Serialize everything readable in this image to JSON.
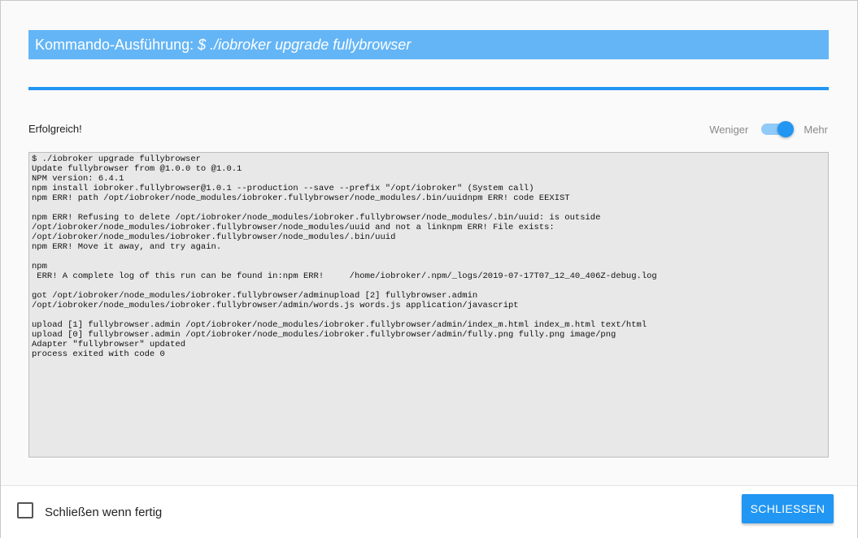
{
  "dialog": {
    "title_prefix": "Kommando-Ausführung: ",
    "title_command": "$ ./iobroker upgrade fullybrowser",
    "status": "Erfolgreich!",
    "progress": 1.0,
    "toggle": {
      "left_label": "Weniger",
      "right_label": "Mehr",
      "state": "Mehr",
      "accent": "#2196f3"
    },
    "log_lines": [
      "$ ./iobroker upgrade fullybrowser",
      "Update fullybrowser from @1.0.0 to @1.0.1",
      "NPM version: 6.4.1",
      "npm install iobroker.fullybrowser@1.0.1 --production --save --prefix \"/opt/iobroker\" (System call)",
      "npm ERR! path /opt/iobroker/node_modules/iobroker.fullybrowser/node_modules/.bin/uuidnpm ERR! code EEXIST",
      "",
      "npm ERR! Refusing to delete /opt/iobroker/node_modules/iobroker.fullybrowser/node_modules/.bin/uuid: is outside",
      "/opt/iobroker/node_modules/iobroker.fullybrowser/node_modules/uuid and not a linknpm ERR! File exists:",
      "/opt/iobroker/node_modules/iobroker.fullybrowser/node_modules/.bin/uuid",
      "npm ERR! Move it away, and try again.",
      "",
      "npm",
      " ERR! A complete log of this run can be found in:npm ERR!     /home/iobroker/.npm/_logs/2019-07-17T07_12_40_406Z-debug.log",
      "",
      "got /opt/iobroker/node_modules/iobroker.fullybrowser/adminupload [2] fullybrowser.admin",
      "/opt/iobroker/node_modules/iobroker.fullybrowser/admin/words.js words.js application/javascript",
      "",
      "upload [1] fullybrowser.admin /opt/iobroker/node_modules/iobroker.fullybrowser/admin/index_m.html index_m.html text/html",
      "upload [0] fullybrowser.admin /opt/iobroker/node_modules/iobroker.fullybrowser/admin/fully.png fully.png image/png",
      "Adapter \"fullybrowser\" updated",
      "process exited with code 0"
    ]
  },
  "footer": {
    "checkbox_label": "Schließen wenn fertig",
    "checkbox_checked": false,
    "close_button_label": "SCHLIESSEN"
  }
}
